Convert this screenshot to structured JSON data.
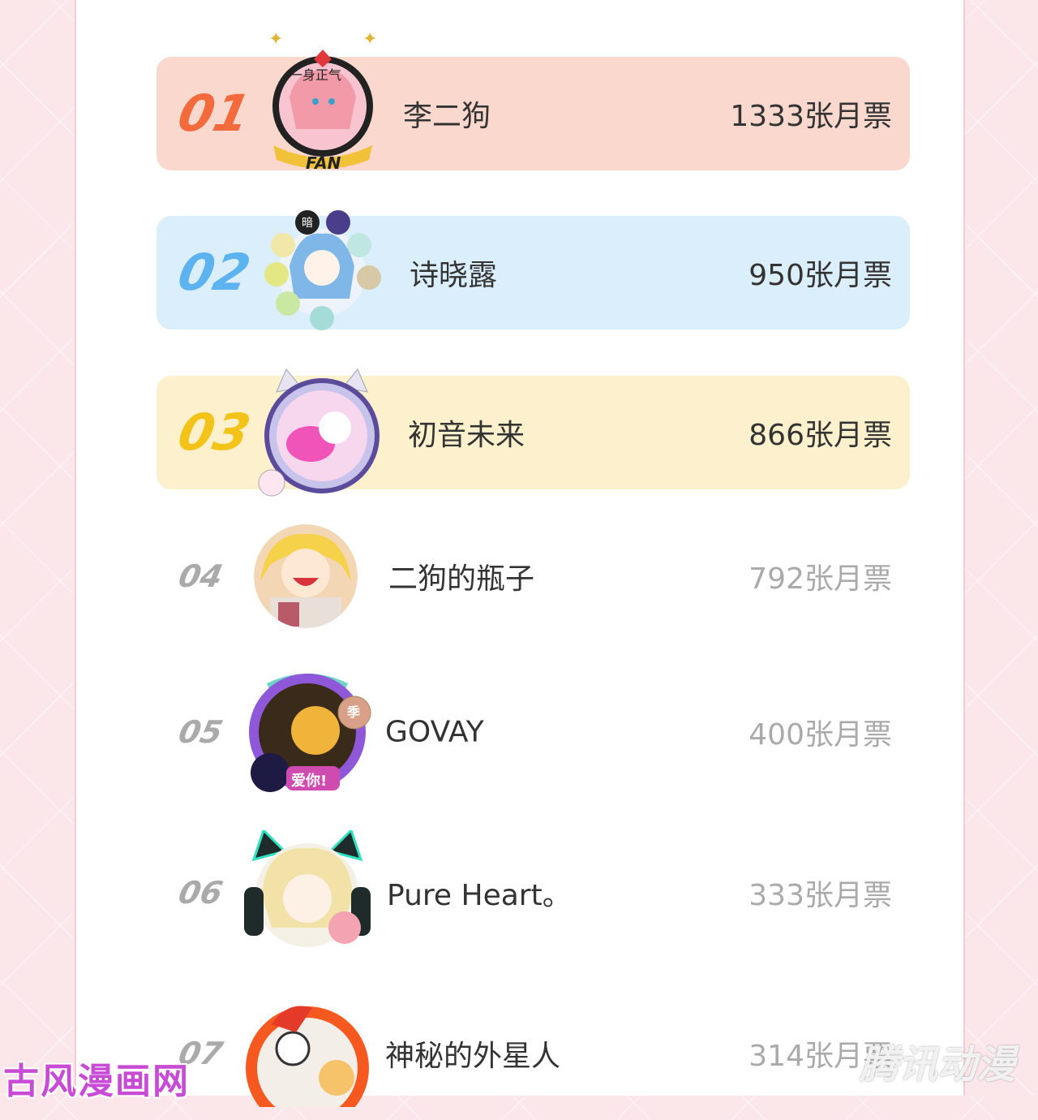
{
  "colors": {
    "rank1_bg": "#fbd8cd",
    "rank1_fg": "#f36a3c",
    "rank2_bg": "#dbeefc",
    "rank2_fg": "#5db3ef",
    "rank3_bg": "#fdf0cd",
    "rank3_fg": "#f3c319"
  },
  "ranking": [
    {
      "rank": "01",
      "name": "李二狗",
      "votes": "1333张月票",
      "avatar_badge": "一身正气",
      "avatar_label": "FAN"
    },
    {
      "rank": "02",
      "name": "诗晓露",
      "votes": "950张月票",
      "avatar_badge": "暗"
    },
    {
      "rank": "03",
      "name": "初音未来",
      "votes": "866张月票"
    },
    {
      "rank": "04",
      "name": "二狗的瓶子",
      "votes": "792张月票"
    },
    {
      "rank": "05",
      "name": "GOVAY",
      "votes": "400张月票",
      "avatar_badge": "季",
      "avatar_label": "爱你!"
    },
    {
      "rank": "06",
      "name": "Pure Heart。",
      "votes": "333张月票"
    },
    {
      "rank": "07",
      "name": "神秘的外星人",
      "votes": "314张月票"
    }
  ],
  "watermarks": {
    "left": "古风漫画网",
    "right": "腾讯动漫"
  }
}
